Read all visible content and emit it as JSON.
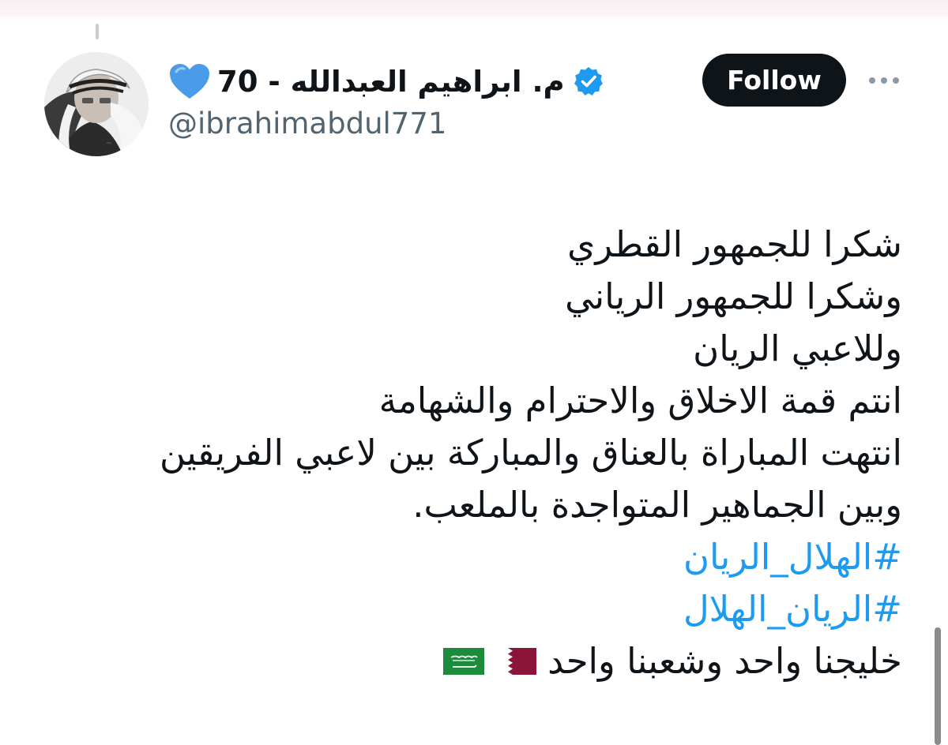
{
  "author": {
    "display_name": "م. ابراهيم العبدالله - 70",
    "handle": "@ibrahimabdul771",
    "name_emoji": "blue-heart-icon",
    "verified_icon": "verified-badge-icon"
  },
  "actions": {
    "follow_label": "Follow",
    "more_icon": "more-dots-icon"
  },
  "tweet": {
    "lines": [
      "شكرا للجمهور القطري",
      "وشكرا للجمهور الرياني",
      "وللاعبي الريان",
      "انتم قمة الاخلاق والاحترام والشهامة",
      "انتهت المباراة بالعناق والمباركة بين لاعبي الفريقين",
      "وبين الجماهير المتواجدة بالملعب."
    ],
    "hashtags": [
      "#الهلال_الريان",
      "#الريان_الهلال"
    ],
    "closing_text": "خليجنا واحد وشعبنا واحد",
    "closing_flags": [
      "qatar-flag-icon",
      "saudi-flag-icon"
    ]
  },
  "colors": {
    "text": "#0f1419",
    "secondary_text": "#536471",
    "hashtag": "#1d9bf0",
    "follow_button_bg": "#0f1419",
    "verified_badge": "#1d9bf0",
    "heart": "#4a9be8",
    "qatar_flag": "#8a1538",
    "saudi_flag": "#1c8c3c"
  }
}
